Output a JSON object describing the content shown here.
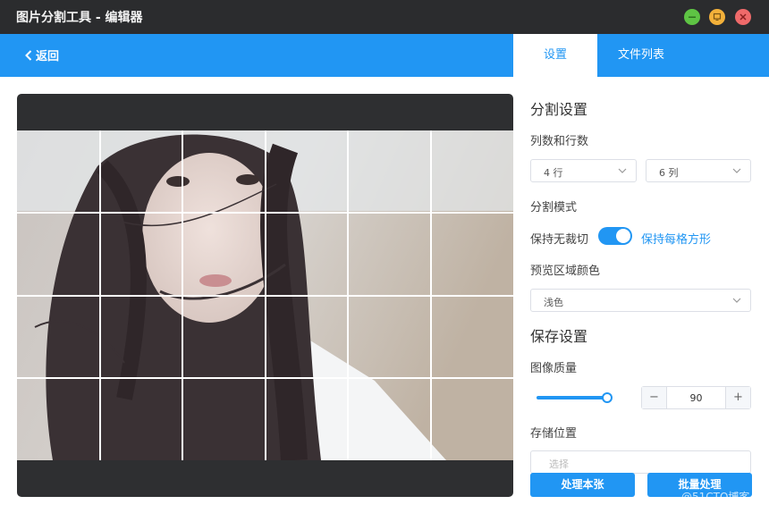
{
  "window": {
    "title": "图片分割工具 - 编辑器",
    "controls": [
      "minimize-icon",
      "maximize-icon",
      "close-icon"
    ],
    "control_colors": {
      "minimize": "#5ec444",
      "maximize": "#f3b13a",
      "close": "#ef6a6a"
    }
  },
  "header": {
    "back_label": "返回",
    "tabs": [
      {
        "label": "设置",
        "active": true
      },
      {
        "label": "文件列表",
        "active": false
      }
    ]
  },
  "colors": {
    "accent": "#2196f3",
    "titlebar": "#2b2c2e",
    "preview_bg": "#2e2f31"
  },
  "preview": {
    "rows": 4,
    "cols": 6,
    "grid_color": "#ffffff"
  },
  "settings": {
    "split_title": "分割设置",
    "grid_label": "列数和行数",
    "rows_value": "4 行",
    "cols_value": "6 列",
    "mode_label": "分割模式",
    "mode_left": "保持无裁切",
    "mode_right": "保持每格方形",
    "mode_toggle_on": true,
    "preview_color_label": "预览区域颜色",
    "preview_color_value": "浅色",
    "save_title": "保存设置",
    "quality_label": "图像质量",
    "quality_value": "90",
    "stepper_minus": "−",
    "stepper_plus": "+",
    "location_label": "存储位置",
    "location_placeholder": "选择",
    "process_one_label": "处理本张",
    "process_batch_label": "批量处理"
  },
  "watermark": "@51CTO博客"
}
